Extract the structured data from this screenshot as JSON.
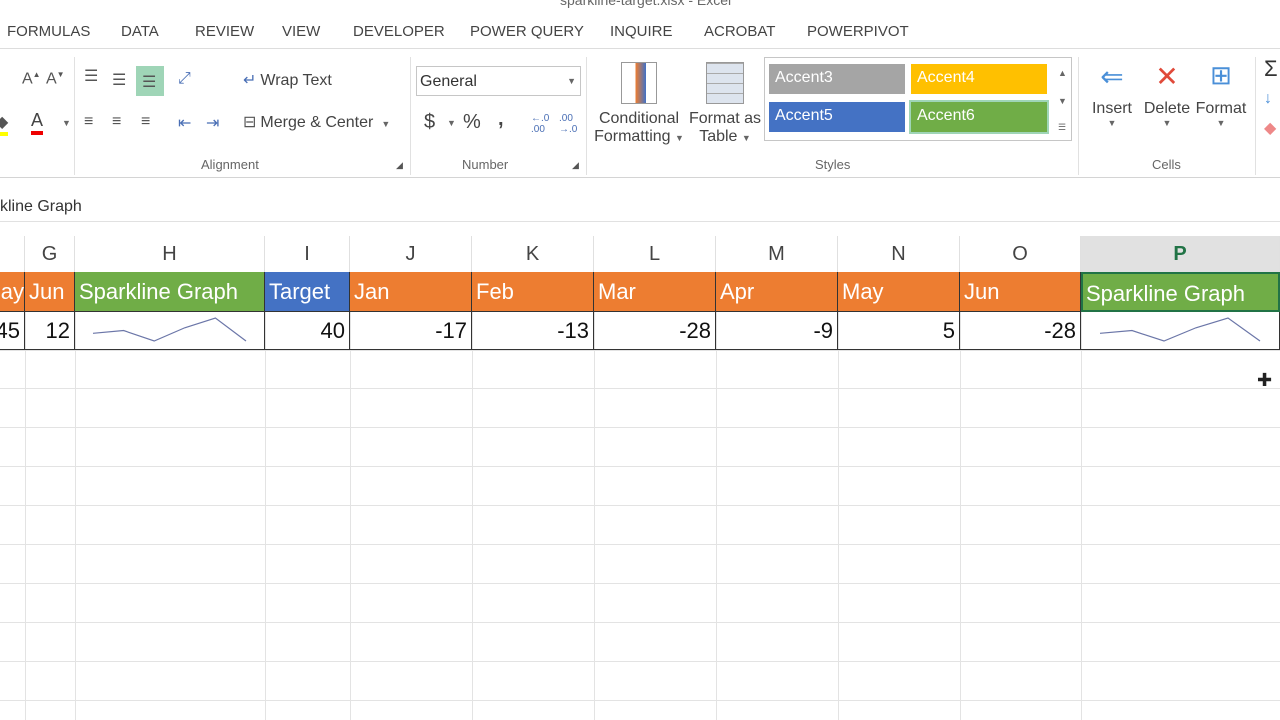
{
  "window": {
    "title": "sparkline-target.xlsx - Excel"
  },
  "tabs": [
    "FORMULAS",
    "DATA",
    "REVIEW",
    "VIEW",
    "DEVELOPER",
    "POWER QUERY",
    "INQUIRE",
    "ACROBAT",
    "POWERPIVOT"
  ],
  "ribbon": {
    "alignment": {
      "label": "Alignment",
      "wrap_text": "Wrap Text",
      "merge_center": "Merge & Center"
    },
    "number": {
      "label": "Number",
      "format": "General",
      "currency": "$",
      "percent": "%",
      "comma": ","
    },
    "styles": {
      "label": "Styles",
      "conditional_1": "Conditional",
      "conditional_2": "Formatting",
      "format_table_1": "Format as",
      "format_table_2": "Table",
      "cell_styles": [
        {
          "name": "Accent3",
          "color": "#a5a5a5"
        },
        {
          "name": "Accent4",
          "color": "#ffc000"
        },
        {
          "name": "Accent5",
          "color": "#4472c4"
        },
        {
          "name": "Accent6",
          "color": "#70ad47"
        }
      ]
    },
    "cells": {
      "label": "Cells",
      "insert": "Insert",
      "delete": "Delete",
      "format": "Format"
    }
  },
  "formula_bar": {
    "value": "kline Graph"
  },
  "columns": [
    "G",
    "H",
    "I",
    "J",
    "K",
    "L",
    "M",
    "N",
    "O",
    "P"
  ],
  "selected_column": "P",
  "header_row": [
    {
      "text": "ay",
      "color": "#ed7d31"
    },
    {
      "text": "Jun",
      "color": "#ed7d31"
    },
    {
      "text": "Sparkline Graph",
      "color": "#70ad47"
    },
    {
      "text": "Target",
      "color": "#4472c4"
    },
    {
      "text": "Jan",
      "color": "#ed7d31"
    },
    {
      "text": "Feb",
      "color": "#ed7d31"
    },
    {
      "text": "Mar",
      "color": "#ed7d31"
    },
    {
      "text": "Apr",
      "color": "#ed7d31"
    },
    {
      "text": "May",
      "color": "#ed7d31"
    },
    {
      "text": "Jun",
      "color": "#ed7d31"
    },
    {
      "text": "Sparkline Graph",
      "color": "#70ad47"
    }
  ],
  "data_row": [
    "45",
    "12",
    "",
    "40",
    "-17",
    "-13",
    "-28",
    "-9",
    "5",
    "-28",
    ""
  ],
  "sparkline_values": [
    -17,
    -13,
    -28,
    -9,
    5,
    -28
  ]
}
